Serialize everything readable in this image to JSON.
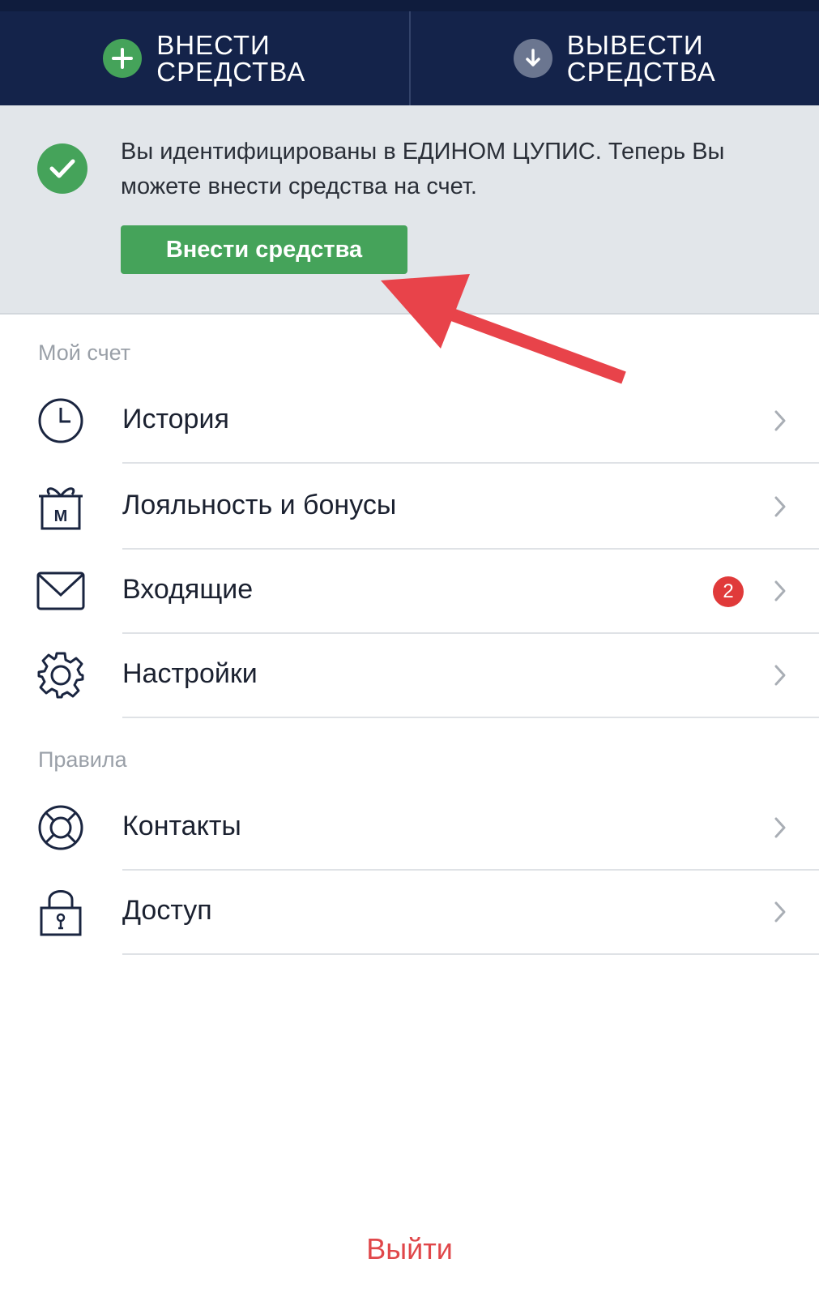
{
  "top_actions": {
    "deposit": {
      "line1": "ВНЕСТИ",
      "line2": "СРЕДСТВА",
      "icon": "plus-icon",
      "color": "#45a35a"
    },
    "withdraw": {
      "line1": "ВЫВЕСТИ",
      "line2": "СРЕДСТВА",
      "icon": "arrow-down-icon",
      "color": "#6b7690"
    }
  },
  "banner": {
    "message": "Вы идентифицированы в ЕДИНОМ ЦУПИС. Теперь Вы можете внести средства на счет.",
    "button_label": "Внести средства",
    "check_icon": "check-icon"
  },
  "sections": {
    "account": {
      "title": "Мой счет",
      "items": [
        {
          "label": "История",
          "icon": "clock-icon"
        },
        {
          "label": "Лояльность и бонусы",
          "icon": "gift-icon",
          "icon_text": "М"
        },
        {
          "label": "Входящие",
          "icon": "envelope-icon",
          "badge": "2"
        },
        {
          "label": "Настройки",
          "icon": "gear-icon"
        }
      ]
    },
    "rules": {
      "title": "Правила",
      "items": [
        {
          "label": "Контакты",
          "icon": "lifebuoy-icon"
        },
        {
          "label": "Доступ",
          "icon": "lock-icon"
        }
      ]
    }
  },
  "logout_label": "Выйти",
  "colors": {
    "navy": "#14234a",
    "green": "#45a35a",
    "red": "#e0474a",
    "badge": "#e03a3a"
  }
}
